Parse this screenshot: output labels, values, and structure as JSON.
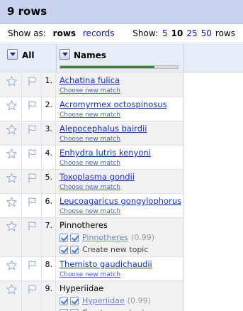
{
  "header": {
    "title": "9 rows"
  },
  "controls": {
    "show_as_label": "Show as:",
    "mode_active": "rows",
    "mode_other": "records",
    "show_label": "Show:",
    "page_sizes": [
      "5",
      "10",
      "25",
      "50"
    ],
    "page_size_selected": "10",
    "suffix": "rows"
  },
  "columns": {
    "all_label": "All",
    "names_label": "Names",
    "names_progress_fraction": 0.8
  },
  "rows": [
    {
      "num": "1.",
      "name": "Achatina fulica",
      "action": "Choose new match"
    },
    {
      "num": "2.",
      "name": "Acromyrmex octospinosus",
      "action": "Choose new match"
    },
    {
      "num": "3.",
      "name": "Alepocephalus bairdii",
      "action": "Choose new match"
    },
    {
      "num": "4.",
      "name": "Enhydra lutris kenyoni",
      "action": "Choose new match"
    },
    {
      "num": "5.",
      "name": "Toxoplasma gondii",
      "action": "Choose new match"
    },
    {
      "num": "6.",
      "name": "Leucoagaricus gongylophorus",
      "action": "Choose new match"
    },
    {
      "num": "7.",
      "name": "Pinnotheres",
      "candidate": "Pinnotheres",
      "score": "(0.99)",
      "new_topic": "Create new topic"
    },
    {
      "num": "8.",
      "name": "Themisto gaudichaudii",
      "action": "Choose new match"
    },
    {
      "num": "9.",
      "name": "Hyperiidae",
      "candidate": "Hyperiidae",
      "score": "(0.99)",
      "new_topic": "Create new topic"
    }
  ],
  "icons": {
    "star": "star-icon",
    "flag": "flag-icon",
    "check": "check-icon"
  }
}
